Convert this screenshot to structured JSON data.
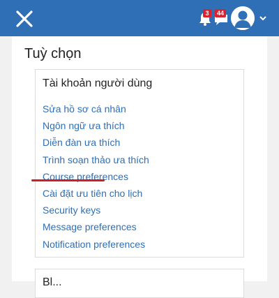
{
  "header": {
    "close_icon": "close-icon",
    "notifications": {
      "icon": "bell-icon",
      "count": "3"
    },
    "messages": {
      "icon": "chat-icon",
      "count": "44"
    },
    "user": {
      "icon": "user-avatar-icon",
      "menu_icon": "chevron-down-icon"
    },
    "colors": {
      "bar": "#2f6fb5",
      "badge": "#d9232e"
    }
  },
  "page": {
    "title": "Tuỳ chọn"
  },
  "user_account": {
    "title": "Tài khoản người dùng",
    "links": [
      "Sửa hồ sơ cá nhân",
      "Ngôn ngữ ưa thích",
      "Diễn đàn ưa thích",
      "Trình soạn thảo ưa thích",
      "Course preferences",
      "Cài đặt ưu tiên cho lịch",
      "Security keys",
      "Message preferences",
      "Notification preferences"
    ],
    "highlighted_link": "Security keys",
    "colors": {
      "link": "#2c6fb8",
      "highlight": "#d21d22"
    }
  },
  "next_section": {
    "title": "Bl..."
  }
}
